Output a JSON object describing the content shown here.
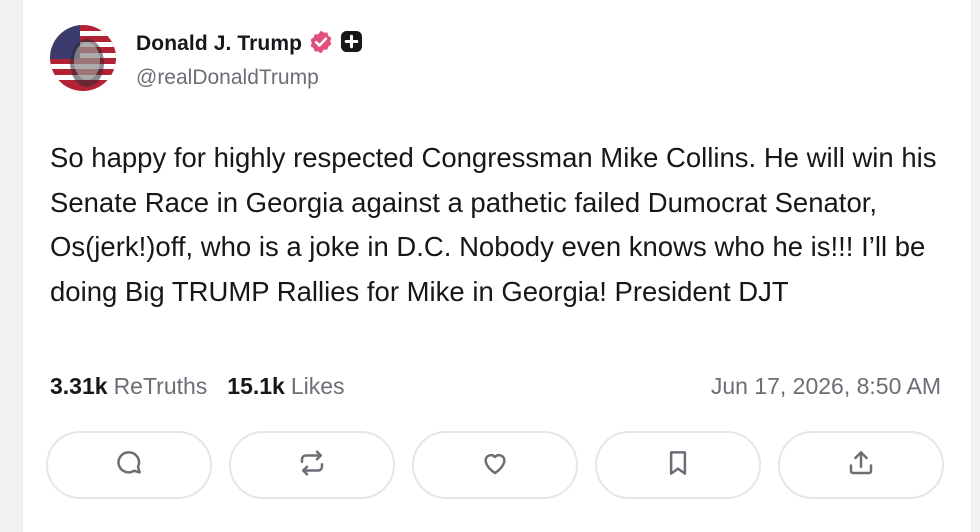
{
  "post": {
    "author": {
      "display_name": "Donald J. Trump",
      "handle": "@realDonaldTrump",
      "verified_icon": "verified-badge-icon",
      "extra_icon": "plus-icon"
    },
    "text": "So happy for highly respected Congressman Mike Collins. He will win his Senate Race in Georgia against a pathetic failed Dumocrat Senator, Os(jerk!)off, who is a joke in D.C. Nobody even knows who he is!!! I’ll be doing Big TRUMP Rallies for Mike in Georgia! President DJT",
    "stats": {
      "retruths_count": "3.31k",
      "retruths_label": "ReTruths",
      "likes_count": "15.1k",
      "likes_label": "Likes"
    },
    "timestamp": "Jun 17, 2026, 8:50 AM"
  },
  "actions": [
    {
      "name": "reply",
      "icon": "comment-icon"
    },
    {
      "name": "retruth",
      "icon": "repost-icon"
    },
    {
      "name": "like",
      "icon": "heart-icon"
    },
    {
      "name": "bookmark",
      "icon": "bookmark-icon"
    },
    {
      "name": "share",
      "icon": "share-icon"
    }
  ],
  "colors": {
    "text_primary": "#16171b",
    "text_secondary": "#6b6e75",
    "badge": "#e0507a",
    "border": "#e6e6ea"
  }
}
